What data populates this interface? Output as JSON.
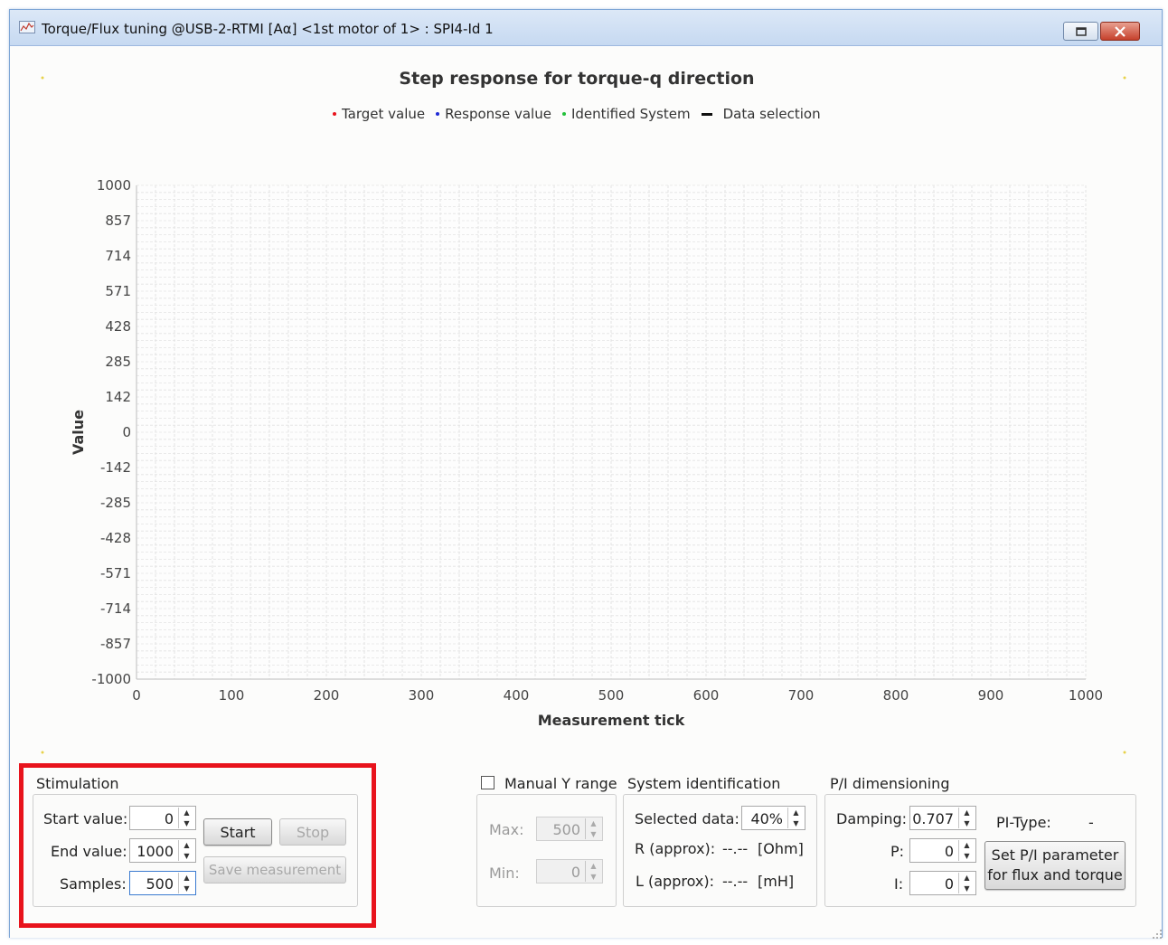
{
  "window": {
    "title": "Torque/Flux tuning @USB-2-RTMI [Aα] <1st motor of 1> : SPI4-Id 1"
  },
  "chart_data": {
    "type": "scatter",
    "title": "Step response for torque-q direction",
    "xlabel": "Measurement tick",
    "ylabel": "Value",
    "xlim": [
      0,
      1000
    ],
    "ylim": [
      -1000,
      1000
    ],
    "x_ticks": [
      "0",
      "100",
      "200",
      "300",
      "400",
      "500",
      "600",
      "700",
      "800",
      "900",
      "1000"
    ],
    "y_ticks": [
      "1000",
      "857",
      "714",
      "571",
      "428",
      "285",
      "142",
      "0",
      "-142",
      "-285",
      "-428",
      "-571",
      "-714",
      "-857",
      "-1000"
    ],
    "grid": true,
    "legend_position": "top",
    "series": [
      {
        "name": "Target value",
        "color": "#e8131c",
        "values": []
      },
      {
        "name": "Response value",
        "color": "#1f2ad6",
        "values": []
      },
      {
        "name": "Identified System",
        "color": "#22c03a",
        "values": []
      },
      {
        "name": "Data selection",
        "color": "#111111",
        "values": []
      }
    ]
  },
  "stimulation": {
    "title": "Stimulation",
    "start_label": "Start value:",
    "start_value": "0",
    "end_label": "End value:",
    "end_value": "1000",
    "samples_label": "Samples:",
    "samples_value": "500",
    "start_button": "Start",
    "stop_button": "Stop",
    "save_button": "Save measurement"
  },
  "manual_y": {
    "checkbox_label": "Manual Y  range",
    "checked": false,
    "max_label": "Max:",
    "max_value": "500",
    "min_label": "Min:",
    "min_value": "0"
  },
  "system_identification": {
    "title": "System identification",
    "selected_label": "Selected data:",
    "selected_value": "40%",
    "r_label": "R (approx):",
    "r_value": "--.--",
    "r_unit": "[Ohm]",
    "l_label": "L (approx):",
    "l_value": "--.--",
    "l_unit": "[mH]"
  },
  "pi_dimensioning": {
    "title": "P/I dimensioning",
    "damping_label": "Damping:",
    "damping_value": "0.707",
    "p_label": "P:",
    "p_value": "0",
    "i_label": "I:",
    "i_value": "0",
    "pi_type_label": "PI-Type:",
    "pi_type_value": "-",
    "set_button_line1": "Set P/I parameter",
    "set_button_line2": "for flux and torque"
  },
  "colors": {
    "highlight": "#e8131c",
    "title_bar": "#c6d9f1",
    "close_button": "#c6412c"
  }
}
